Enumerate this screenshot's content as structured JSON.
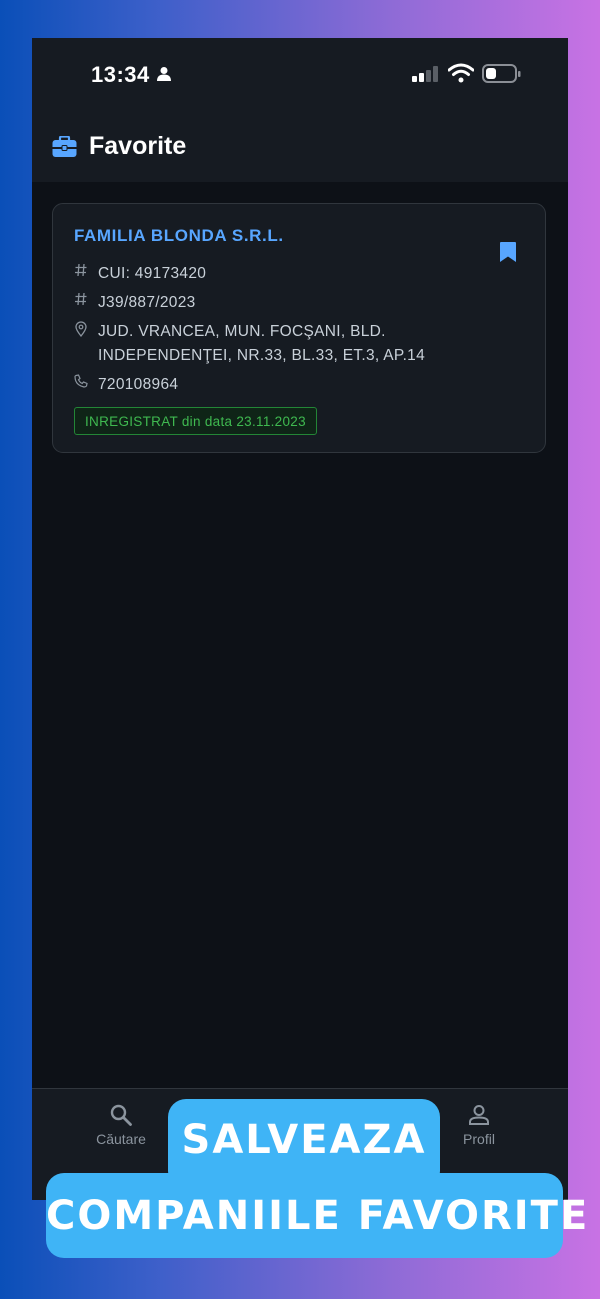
{
  "status_bar": {
    "time": "13:34",
    "icons": [
      "person-icon",
      "signal-icon",
      "wifi-icon",
      "battery-icon"
    ]
  },
  "header": {
    "title": "Favorite",
    "icon": "briefcase-icon"
  },
  "favorites": [
    {
      "name": "FAMILIA BLONDA S.R.L.",
      "cui": "CUI: 49173420",
      "registration": "J39/887/2023",
      "address_line1": "JUD. VRANCEA, MUN. FOCŞANI, BLD.",
      "address_line2": "INDEPENDENŢEI, NR.33, BL.33, ET.3, AP.14",
      "phone": "720108964",
      "status": "INREGISTRAT din data 23.11.2023",
      "bookmarked": true
    }
  ],
  "tab_bar": {
    "search_label": "Căutare",
    "profile_label": "Profil"
  },
  "promo": {
    "line1": "SALVEAZA",
    "line2": "COMPANIILE FAVORITE"
  },
  "colors": {
    "accent": "#58a6ff",
    "status_green": "#3fb950",
    "promo_blue": "#3fb4f6",
    "background": "#0d1117"
  }
}
